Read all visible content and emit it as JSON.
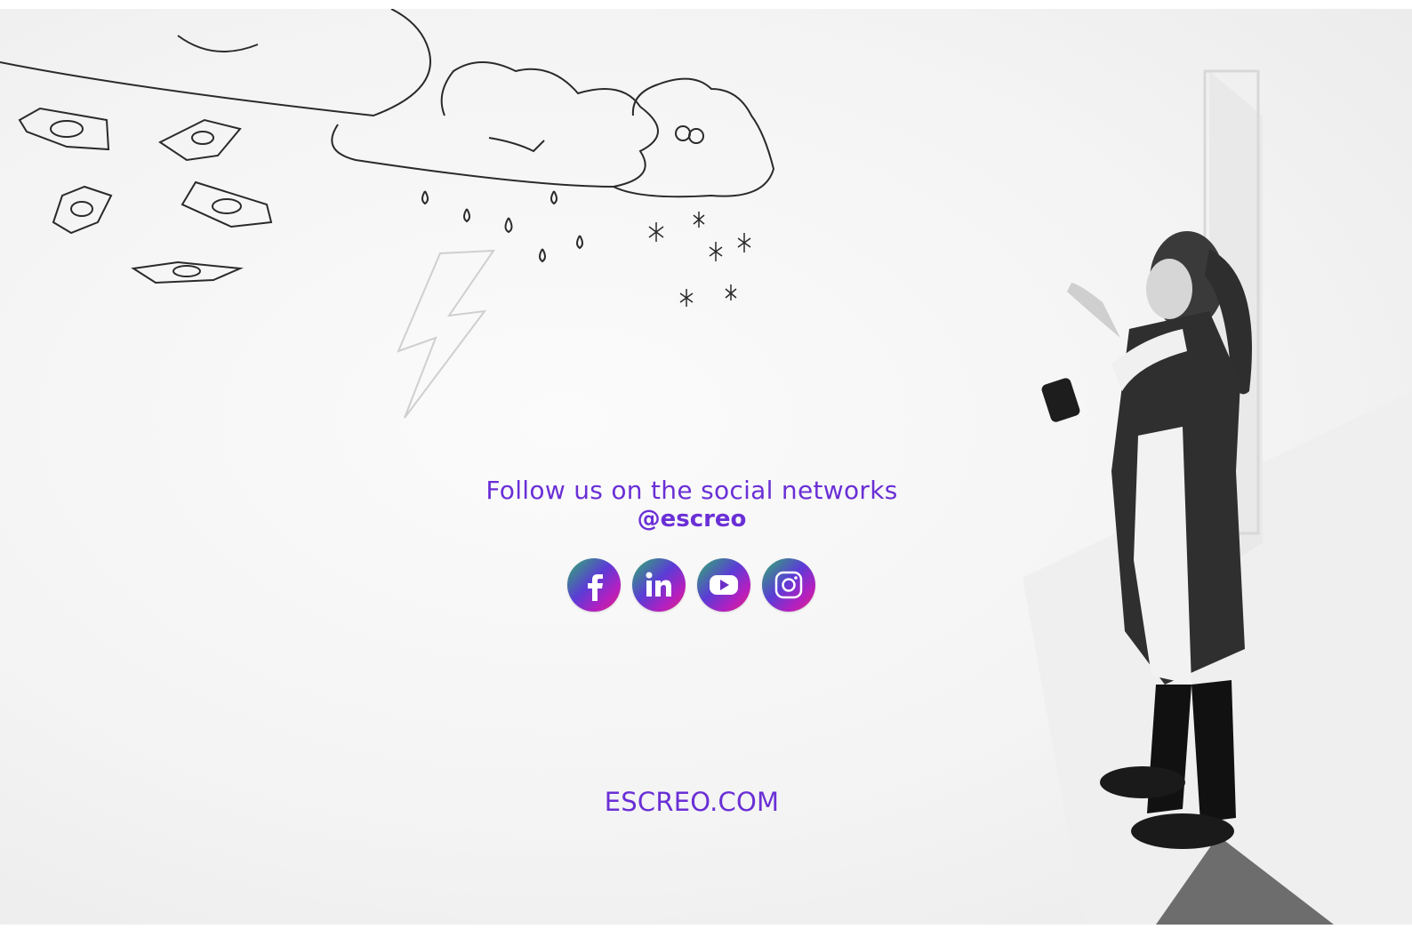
{
  "follow": {
    "text": "Follow us on the social networks",
    "handle_at": "@",
    "handle_name": "escreo"
  },
  "socials": [
    {
      "name": "facebook",
      "icon": "facebook-icon"
    },
    {
      "name": "linkedin",
      "icon": "linkedin-icon"
    },
    {
      "name": "youtube",
      "icon": "youtube-icon"
    },
    {
      "name": "instagram",
      "icon": "instagram-icon"
    }
  ],
  "website": "ESCREO.COM",
  "colors": {
    "accent": "#6a2fd6",
    "icon_gradient": [
      "#2db36b",
      "#5b3cd6",
      "#b41fbf",
      "#e0267a"
    ]
  }
}
